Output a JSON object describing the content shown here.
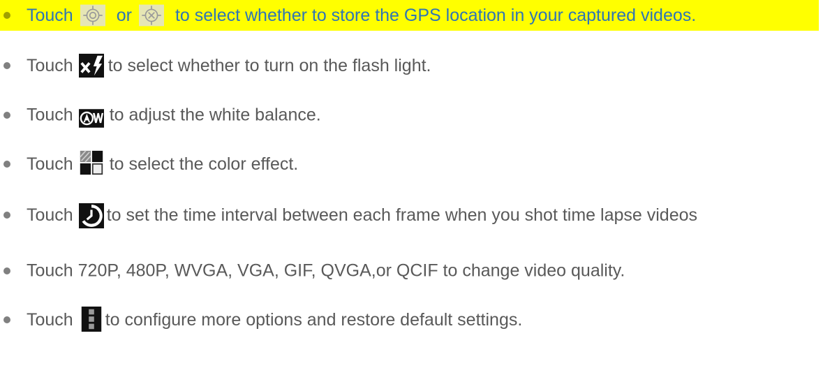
{
  "colors": {
    "highlight": "#ffff00",
    "text": "#595959",
    "bullet": "#808080",
    "icon_dark": "#111111"
  },
  "items": [
    {
      "highlighted": true,
      "touch": "Touch",
      "or": "or",
      "text": "to select whether to store the GPS location in your captured videos.",
      "icons": [
        "gps-on-icon",
        "gps-off-icon"
      ]
    },
    {
      "touch": "Touch",
      "text": "to select whether to turn on the flash light.",
      "icons": [
        "flash-off-icon"
      ]
    },
    {
      "touch": "Touch",
      "text": "to adjust the white balance.",
      "icons": [
        "white-balance-auto-icon"
      ]
    },
    {
      "touch": "Touch",
      "text": "to select the color effect.",
      "icons": [
        "color-effect-icon"
      ]
    },
    {
      "touch": "Touch",
      "text": "to set the time interval between each frame when you shot time lapse videos",
      "icons": [
        "time-lapse-icon"
      ]
    },
    {
      "text": "Touch 720P, 480P, WVGA, VGA, GIF, QVGA,or QCIF to change video quality."
    },
    {
      "touch": "Touch",
      "text": "to configure more options and restore default settings.",
      "icons": [
        "more-options-icon"
      ]
    }
  ]
}
